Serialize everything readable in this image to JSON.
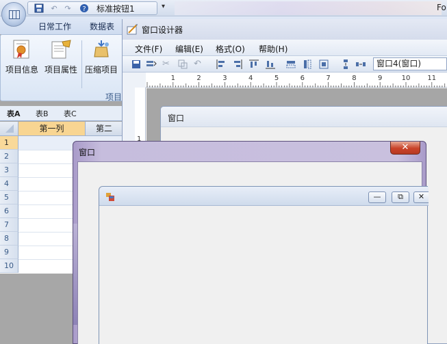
{
  "quick_access": {
    "title": "标准按钮1",
    "dropdown": "▾",
    "top_right_text": "Fo"
  },
  "ribbon": {
    "tabs": [
      "日常工作",
      "数据表"
    ],
    "buttons": [
      {
        "label": "项目信息",
        "icon": "certificate-icon"
      },
      {
        "label": "项目属性",
        "icon": "project-properties-icon"
      },
      {
        "label": "压缩项目",
        "icon": "compress-project-icon"
      }
    ],
    "group_label": "项目"
  },
  "sheet": {
    "tabs": [
      "表A",
      "表B",
      "表C"
    ],
    "columns": [
      "第一列",
      "第二"
    ],
    "rows": [
      "1",
      "2",
      "3",
      "4",
      "5",
      "6",
      "7",
      "8",
      "9",
      "10"
    ]
  },
  "designer": {
    "title": "窗口设计器",
    "menu": [
      "文件(F)",
      "编辑(E)",
      "格式(O)",
      "帮助(H)"
    ],
    "selector_value": "窗口4(窗口)",
    "ruler_labels": [
      "1",
      "2",
      "3",
      "4",
      "5",
      "6",
      "7",
      "8",
      "9",
      "10",
      "11"
    ],
    "vruler_label": "1",
    "form_title": "窗口"
  },
  "dialog": {
    "title": "窗口",
    "close_glyph": "✕",
    "caption_glyphs": {
      "minimize": "—",
      "restore": "⧉",
      "close": "✕"
    }
  },
  "colors": {
    "ribbon_blue": "#dfe8f6",
    "dialog_frame": "#c6bddd",
    "close_red": "#c9432a",
    "selected_row": "#f9d99a"
  }
}
